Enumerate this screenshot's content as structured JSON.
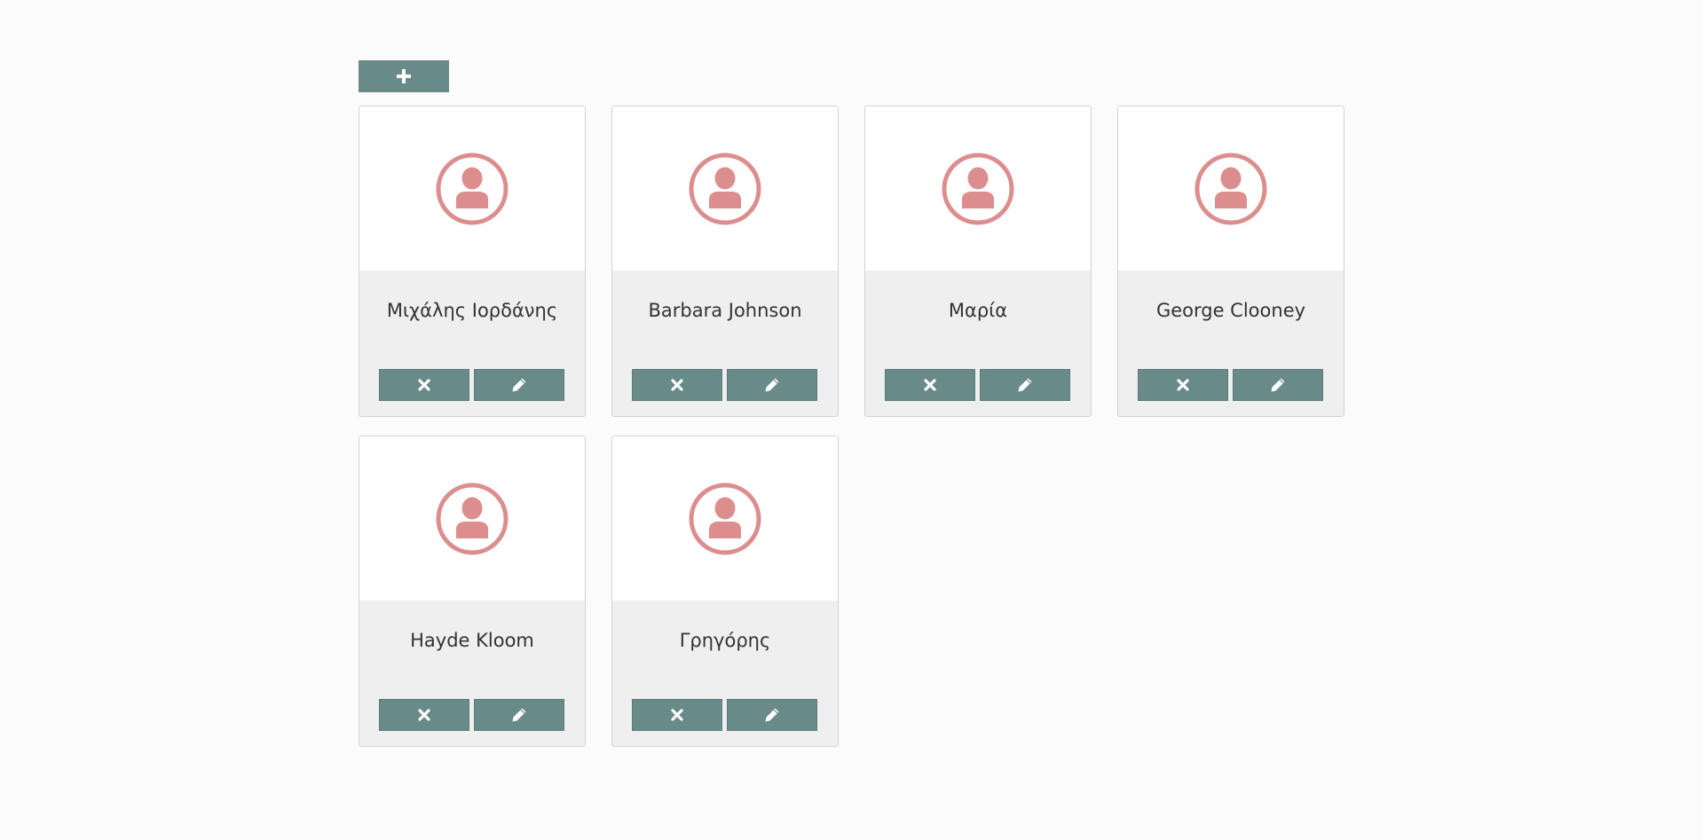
{
  "toolbar": {
    "add_icon": "plus-icon"
  },
  "contacts": [
    {
      "name": "Μιχάλης Ιορδάνης"
    },
    {
      "name": "Barbara Johnson"
    },
    {
      "name": "Μαρία"
    },
    {
      "name": "George Clooney"
    },
    {
      "name": "Hayde Kloom"
    },
    {
      "name": "Γρηγόρης"
    }
  ],
  "icons": {
    "avatar": "user-circle-icon",
    "delete": "close-icon",
    "edit": "pencil-icon"
  },
  "colors": {
    "button": "#688a88",
    "avatar": "#dc8e8e",
    "card_bottom": "#efefef",
    "background": "#fbfbfb"
  }
}
